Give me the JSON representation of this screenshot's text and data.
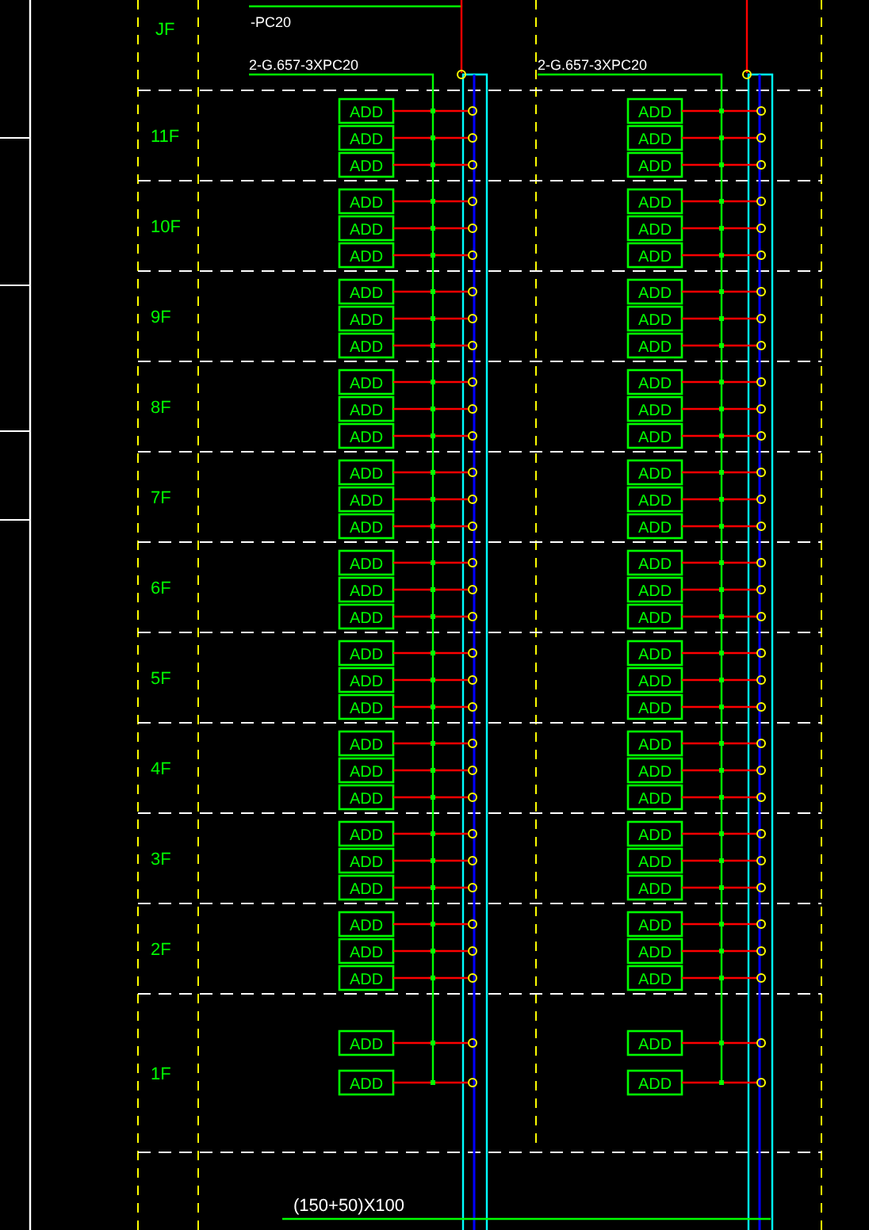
{
  "top_note": "-PC20",
  "top_floor": "JF",
  "cable_labels": [
    "2-G.657-3XPC20",
    "2-G.657-3XPC20"
  ],
  "floors": [
    {
      "label": "11F",
      "left": [
        "ADD",
        "ADD",
        "ADD"
      ],
      "right": [
        "ADD",
        "ADD",
        "ADD"
      ]
    },
    {
      "label": "10F",
      "left": [
        "ADD",
        "ADD",
        "ADD"
      ],
      "right": [
        "ADD",
        "ADD",
        "ADD"
      ]
    },
    {
      "label": "9F",
      "left": [
        "ADD",
        "ADD",
        "ADD"
      ],
      "right": [
        "ADD",
        "ADD",
        "ADD"
      ]
    },
    {
      "label": "8F",
      "left": [
        "ADD",
        "ADD",
        "ADD"
      ],
      "right": [
        "ADD",
        "ADD",
        "ADD"
      ]
    },
    {
      "label": "7F",
      "left": [
        "ADD",
        "ADD",
        "ADD"
      ],
      "right": [
        "ADD",
        "ADD",
        "ADD"
      ]
    },
    {
      "label": "6F",
      "left": [
        "ADD",
        "ADD",
        "ADD"
      ],
      "right": [
        "ADD",
        "ADD",
        "ADD"
      ]
    },
    {
      "label": "5F",
      "left": [
        "ADD",
        "ADD",
        "ADD"
      ],
      "right": [
        "ADD",
        "ADD",
        "ADD"
      ]
    },
    {
      "label": "4F",
      "left": [
        "ADD",
        "ADD",
        "ADD"
      ],
      "right": [
        "ADD",
        "ADD",
        "ADD"
      ]
    },
    {
      "label": "3F",
      "left": [
        "ADD",
        "ADD",
        "ADD"
      ],
      "right": [
        "ADD",
        "ADD",
        "ADD"
      ]
    },
    {
      "label": "2F",
      "left": [
        "ADD",
        "ADD",
        "ADD"
      ],
      "right": [
        "ADD",
        "ADD",
        "ADD"
      ]
    },
    {
      "label": "1F",
      "left": [
        "ADD",
        "ADD"
      ],
      "right": [
        "ADD",
        "ADD"
      ]
    }
  ],
  "dimension": "(150+50)X100"
}
